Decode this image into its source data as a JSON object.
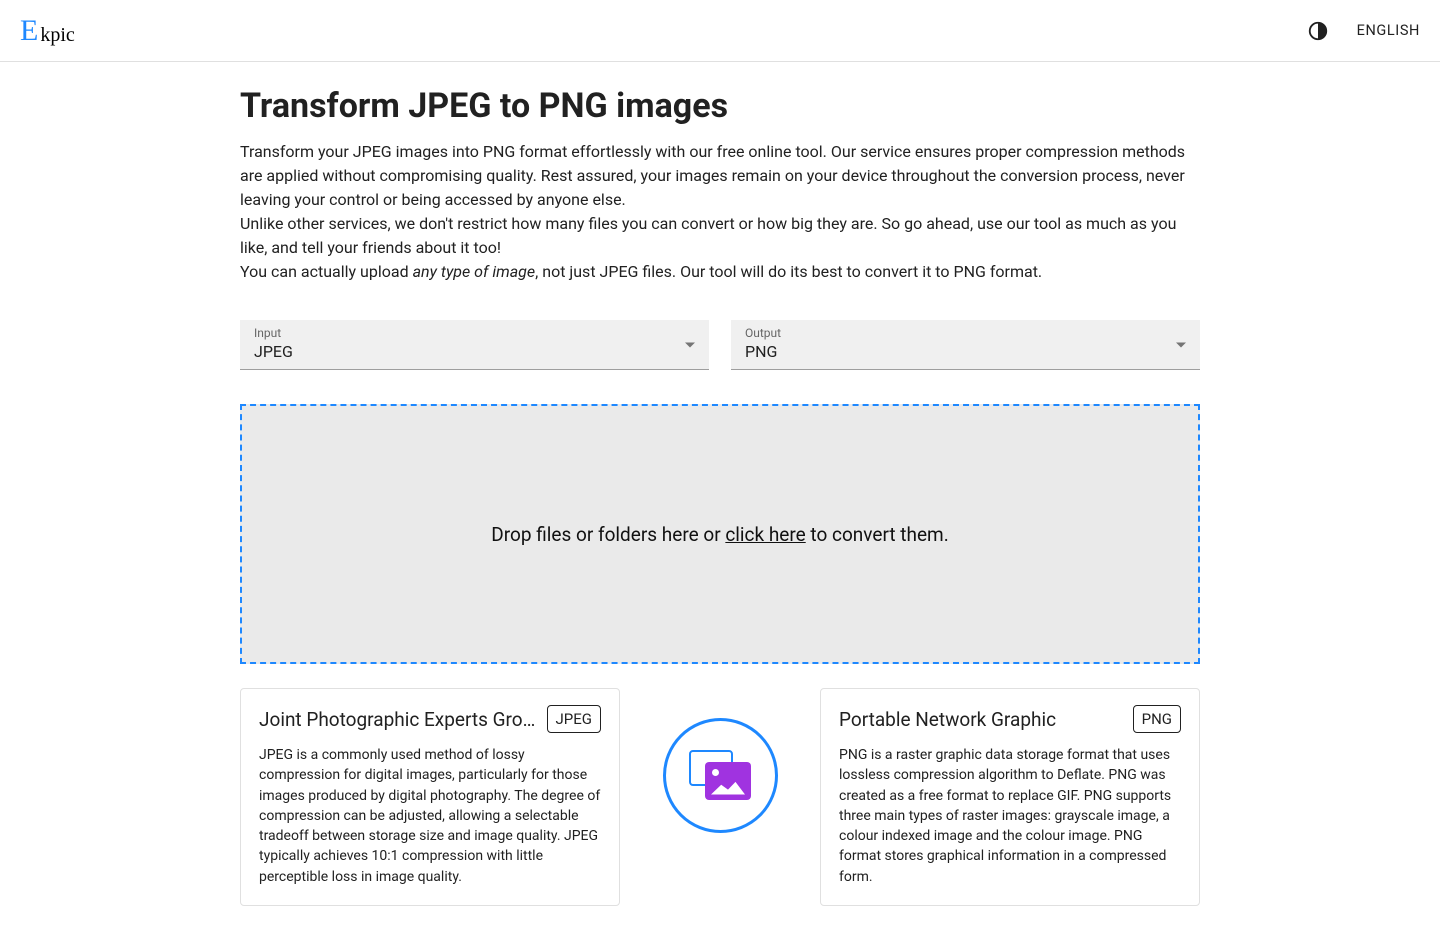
{
  "header": {
    "brand_e": "E",
    "brand_rest": "kpic",
    "language": "ENGLISH"
  },
  "page": {
    "title": "Transform JPEG to PNG images",
    "p1": "Transform your JPEG images into PNG format effortlessly with our free online tool. Our service ensures proper compression methods are applied without compromising quality. Rest assured, your images remain on your device throughout the conversion process, never leaving your control or being accessed by anyone else.",
    "p2": "Unlike other services, we don't restrict how many files you can convert or how big they are. So go ahead, use our tool as much as you like, and tell your friends about it too!",
    "p3_pre": "You can actually upload ",
    "p3_em": "any type of image",
    "p3_post": ", not just JPEG files. Our tool will do its best to convert it to PNG format."
  },
  "selects": {
    "input_label": "Input",
    "input_value": "JPEG",
    "output_label": "Output",
    "output_value": "PNG"
  },
  "dropzone": {
    "pre": "Drop files or folders here or ",
    "link": "click here",
    "post": " to convert them."
  },
  "cards": {
    "left": {
      "title": "Joint Photographic Experts Gro…",
      "badge": "JPEG",
      "body": "JPEG is a commonly used method of lossy compression for digital images, particularly for those images produced by digital photography. The degree of compression can be adjusted, allowing a selectable tradeoff between storage size and image quality. JPEG typically achieves 10:1 compression with little perceptible loss in image quality."
    },
    "right": {
      "title": "Portable Network Graphic",
      "badge": "PNG",
      "body": "PNG is a raster graphic data storage format that uses lossless compression algorithm to Deflate. PNG was created as a free format to replace GIF. PNG supports three main types of raster images: grayscale image, a colour indexed image and the colour image. PNG format stores graphical information in a compressed form."
    }
  }
}
